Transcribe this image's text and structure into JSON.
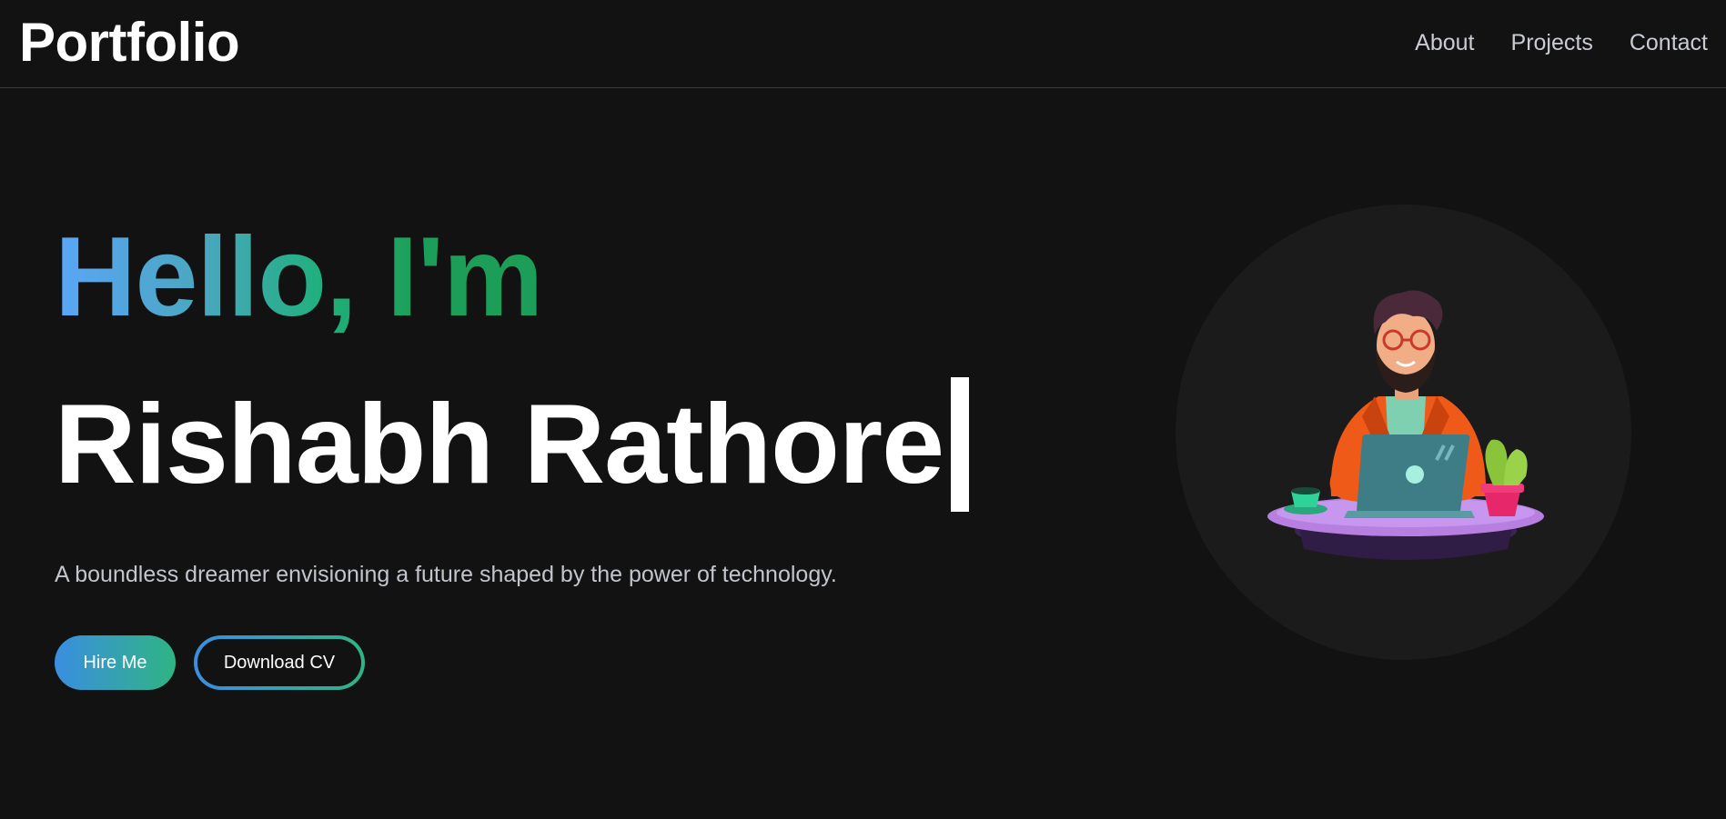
{
  "nav": {
    "brand": "Portfolio",
    "links": [
      "About",
      "Projects",
      "Contact"
    ]
  },
  "hero": {
    "greeting": "Hello, I'm",
    "name": "Rishabh Rathore",
    "tagline": "A boundless dreamer envisioning a future shaped by the power of technology.",
    "hire_label": "Hire Me",
    "cv_label": "Download CV"
  },
  "colors": {
    "background": "#121212",
    "gradient_start": "#5aa6f8",
    "gradient_end": "#1d9e58"
  }
}
